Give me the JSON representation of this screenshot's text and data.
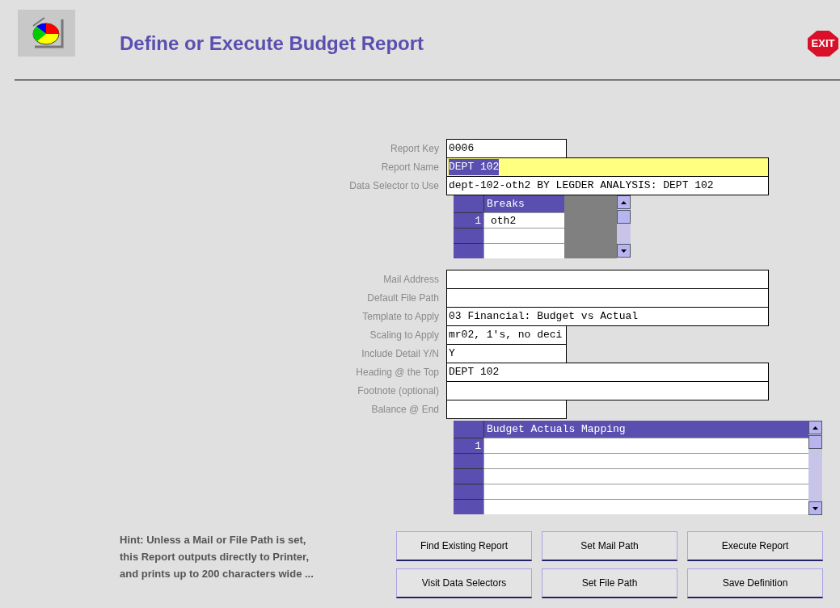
{
  "title": "Define or Execute Budget Report",
  "exit_button": {
    "label": "EXIT"
  },
  "top_fields": [
    {
      "label": "Report Key",
      "value": "0006",
      "kind": "short",
      "focused": false,
      "selected": false
    },
    {
      "label": "Report Name",
      "value": "DEPT 102",
      "kind": "wide",
      "focused": true,
      "selected": true
    },
    {
      "label": "Data Selector to Use",
      "value": "dept-102-oth2 BY LEGDER ANALYSIS: DEPT 102",
      "kind": "wide",
      "focused": false,
      "selected": false
    }
  ],
  "breaks_grid": {
    "header": "Breaks",
    "rows": [
      {
        "number": "1",
        "value": "oth2"
      }
    ]
  },
  "fields": [
    {
      "label": "Mail Address",
      "kind": "wide"
    },
    {
      "label": "Default File Path",
      "kind": "wide"
    },
    {
      "label": "Template to Apply",
      "value": "03 Financial: Budget vs Actual",
      "kind": "wide"
    },
    {
      "label": "Scaling to Apply",
      "value": "mr02, 1's, no deci",
      "kind": "short"
    },
    {
      "label": "Include Detail Y/N",
      "value": "Y",
      "kind": "short"
    },
    {
      "label": "Heading @ the Top",
      "value": "DEPT 102",
      "kind": "wide"
    },
    {
      "label": "Footnote (optional)",
      "kind": "wide"
    },
    {
      "label": "Balance @ End",
      "kind": "short"
    }
  ],
  "mapping_grid": {
    "header": "Budget Actuals Mapping",
    "rows": [
      {
        "number": "1"
      }
    ]
  },
  "hint": "Hint: Unless a Mail or File Path is set, this Report outputs directly to Printer, and prints up to 200 characters wide ...",
  "buttons": [
    {
      "label": "Find Existing Report"
    },
    {
      "label": "Set Mail Path"
    },
    {
      "label": "Execute Report"
    },
    {
      "label": "Visit Data Selectors"
    },
    {
      "label": "Set File Path"
    },
    {
      "label": "Save Definition"
    }
  ]
}
